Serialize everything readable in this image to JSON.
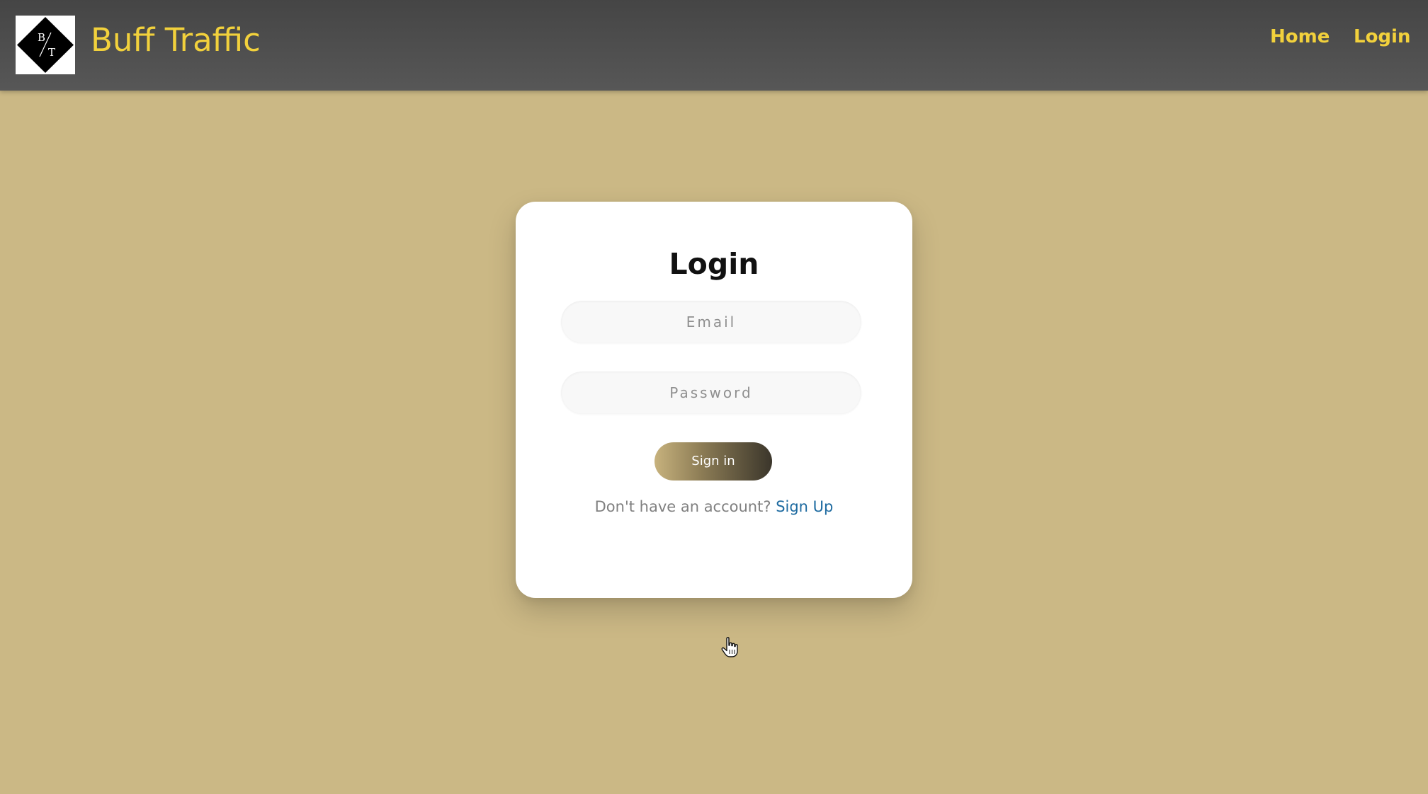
{
  "navbar": {
    "logo_letters": [
      "B",
      "T"
    ],
    "brand": "Buff Traffic",
    "links": [
      "Home",
      "Login"
    ]
  },
  "login_card": {
    "title": "Login",
    "email_placeholder": "Email",
    "password_placeholder": "Password",
    "submit_label": "Sign in",
    "signup_prompt": "Don't have an account?",
    "signup_link": "Sign Up"
  },
  "colors": {
    "background": "#cbb885",
    "navbar": "#4e4e4e",
    "accent_yellow": "#f2d13c",
    "link_blue": "#1d6aa0"
  },
  "icons": [
    "bt-logo-icon",
    "hand-pointer-cursor-icon"
  ]
}
